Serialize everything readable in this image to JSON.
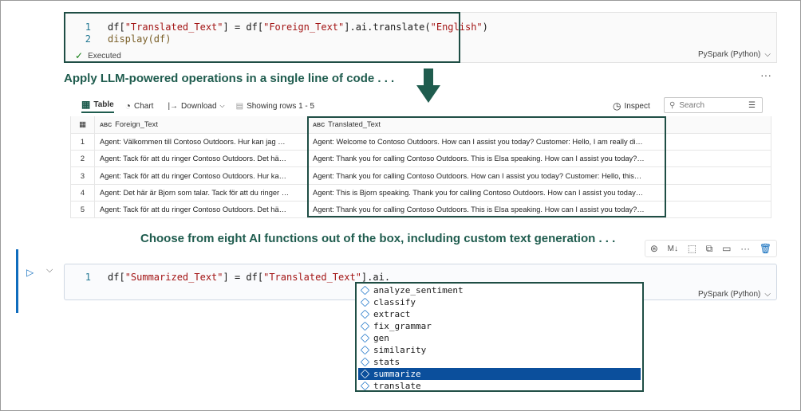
{
  "cell1": {
    "lines": [
      {
        "num": "1",
        "a": "df[",
        "s1": "\"Translated_Text\"",
        "b": "] = df[",
        "s2": "\"Foreign_Text\"",
        "c": "].ai.translate(",
        "s3": "\"English\"",
        "d": ")"
      },
      {
        "num": "2",
        "a": "display(df)"
      }
    ],
    "status": "Executed",
    "language": "PySpark (Python)"
  },
  "heading1": "Apply LLM-powered operations in a single line of code . . .",
  "more": "···",
  "toolbar": {
    "table": "Table",
    "chart": "Chart",
    "download": "Download",
    "rows": "Showing rows 1 - 5",
    "inspect": "Inspect",
    "search_placeholder": "Search"
  },
  "table": {
    "columns": [
      "Foreign_Text",
      "Translated_Text"
    ],
    "type_badge": "ABC",
    "rows": [
      {
        "idx": "1",
        "foreign": "Agent: Välkommen till Contoso Outdoors. Hur kan jag …",
        "translated": "Agent: Welcome to Contoso Outdoors. How can I assist you today? Customer: Hello, I am really di…"
      },
      {
        "idx": "2",
        "foreign": "Agent: Tack för att du ringer Contoso Outdoors. Det hä…",
        "translated": "Agent: Thank you for calling Contoso Outdoors. This is Elsa speaking. How can I assist you today?…"
      },
      {
        "idx": "3",
        "foreign": "Agent: Tack för att du ringer Contoso Outdoors. Hur ka…",
        "translated": "Agent: Thank you for calling Contoso Outdoors. How can I assist you today? Customer: Hello, this…"
      },
      {
        "idx": "4",
        "foreign": "Agent: Det här är Bjorn som talar. Tack för att du ringer …",
        "translated": "Agent: This is Bjorn speaking. Thank you for calling Contoso Outdoors. How can I assist you today…"
      },
      {
        "idx": "5",
        "foreign": "Agent: Tack för att du ringer Contoso Outdoors. Det hä…",
        "translated": "Agent: Thank you for calling Contoso Outdoors. This is Elsa speaking. How can I assist you today?…"
      }
    ]
  },
  "heading2": "Choose from eight AI functions out of the box, including custom text generation . . .",
  "cell2": {
    "num": "1",
    "a": "df[",
    "s1": "\"Summarized_Text\"",
    "b": "] = df[",
    "s2": "\"Translated_Text\"",
    "c": "].ai.",
    "language": "PySpark (Python)"
  },
  "autocomplete": {
    "items": [
      "analyze_sentiment",
      "classify",
      "extract",
      "fix_grammar",
      "gen",
      "similarity",
      "stats",
      "summarize",
      "translate"
    ],
    "selected": "summarize"
  },
  "colors": {
    "accent": "#1f5c4e",
    "outline": "#1f4e45",
    "selection": "#0b4f9c"
  }
}
